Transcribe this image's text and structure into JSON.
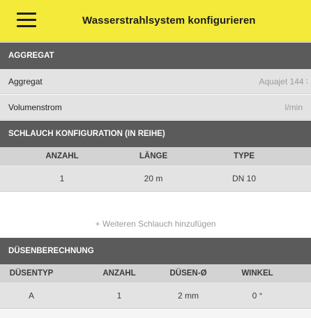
{
  "header": {
    "title": "Wasserstrahlsystem konfigurieren",
    "menu_icon": "menu-icon"
  },
  "aggregat": {
    "section_title": "AGGREGAT",
    "rows": [
      {
        "label": "Aggregat",
        "value": "Aquajet 144 ∶"
      },
      {
        "label": "Volumenstrom",
        "value": "l/min"
      }
    ]
  },
  "schlauch": {
    "section_title": "SCHLAUCH KONFIGURATION (IN REIHE)",
    "columns": [
      "ANZAHL",
      "LÄNGE",
      "TYPE"
    ],
    "rows": [
      {
        "anzahl": "1",
        "laenge": "20 m",
        "type": "DN 10"
      }
    ],
    "add_label": "+ Weiteren Schlauch hinzufügen"
  },
  "duesen": {
    "section_title": "DÜSENBERECHNUNG",
    "columns": [
      "DÜSENTYP",
      "ANZAHL",
      "DÜSEN-Ø",
      "WINKEL"
    ],
    "rows": [
      {
        "typ": "A",
        "anzahl": "1",
        "durchmesser": "2 mm",
        "winkel": "0 °"
      }
    ]
  },
  "colors": {
    "accent": "#f4ea3a",
    "section_bg": "#5b5b5b",
    "row_bg": "#e3e3e3",
    "table_header_bg": "#d3d3d3"
  }
}
